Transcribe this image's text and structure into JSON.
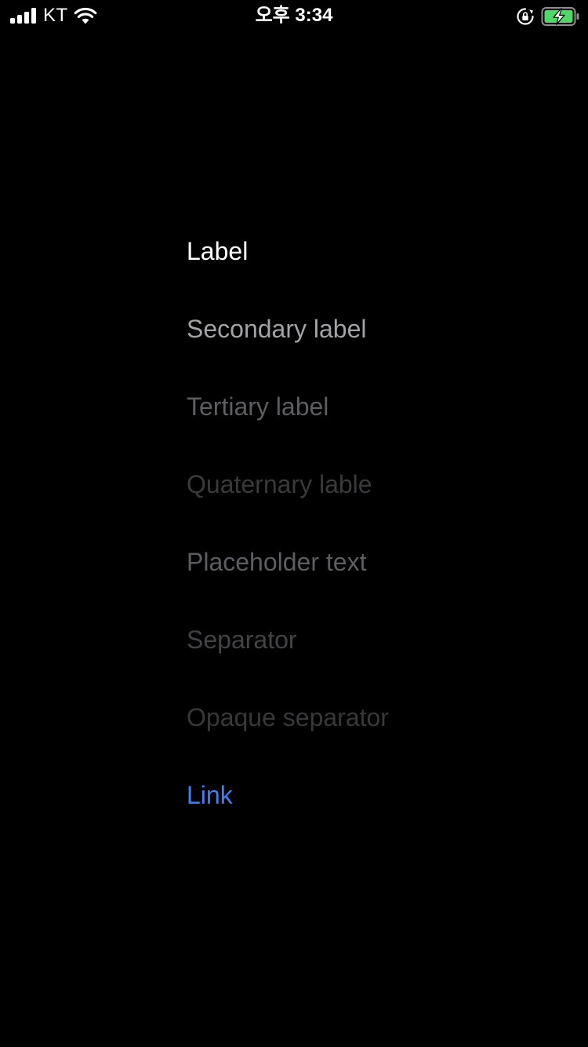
{
  "status_bar": {
    "carrier": "KT",
    "time": "오후 3:34",
    "icons": [
      "signal-icon",
      "wifi-icon",
      "rotation-lock-icon",
      "battery-charging-icon"
    ],
    "battery_color": "#4cd964"
  },
  "labels": {
    "label": {
      "text": "Label",
      "color": "#ffffff"
    },
    "secondary": {
      "text": "Secondary label",
      "color": "#a2a2a7"
    },
    "tertiary": {
      "text": "Tertiary label",
      "color": "#5d5d62"
    },
    "quaternary": {
      "text": "Quaternary lable",
      "color": "#3a3a3c"
    },
    "placeholder": {
      "text": "Placeholder text",
      "color": "#5d5d62"
    },
    "separator": {
      "text": "Separator",
      "color": "#434346"
    },
    "opaque_separator": {
      "text": "Opaque separator",
      "color": "#38383a"
    },
    "link": {
      "text": "Link",
      "color": "#3c82f6"
    }
  }
}
